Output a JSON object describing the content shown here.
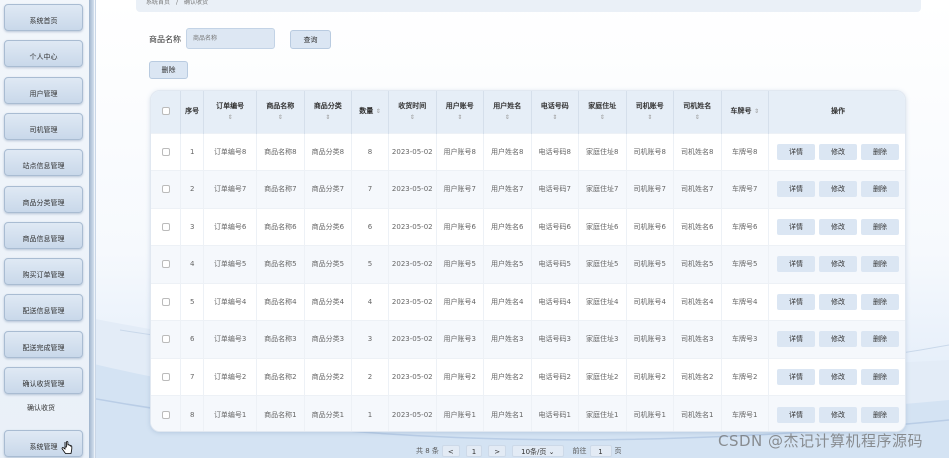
{
  "breadcrumb": [
    "系统首页",
    "确认收货"
  ],
  "sidebar": {
    "items": [
      {
        "label": "系统首页"
      },
      {
        "label": "个人中心"
      },
      {
        "label": "用户管理"
      },
      {
        "label": "司机管理"
      },
      {
        "label": "站点信息管理"
      },
      {
        "label": "商品分类管理"
      },
      {
        "label": "商品信息管理"
      },
      {
        "label": "购买订单管理"
      },
      {
        "label": "配送信息管理"
      },
      {
        "label": "配送完成管理"
      },
      {
        "label": "确认收货管理"
      }
    ],
    "subitem": {
      "label": "确认收货"
    },
    "last_item": {
      "label": "系统管理"
    }
  },
  "search": {
    "label": "商品名称",
    "placeholder": "商品名称",
    "query_button": "查询",
    "delete_button": "删除"
  },
  "table": {
    "headers": [
      "序号",
      "订单编号",
      "商品名称",
      "商品分类",
      "数量",
      "收货时间",
      "用户账号",
      "用户姓名",
      "电话号码",
      "家庭住址",
      "司机账号",
      "司机姓名",
      "车牌号",
      "操作"
    ],
    "sort_icon": "⇕",
    "rows": [
      {
        "index": "1",
        "order": "订单编号8",
        "name": "商品名称8",
        "category": "商品分类8",
        "qty": "8",
        "time": "2023-05-02",
        "user": "用户账号8",
        "uname": "用户姓名8",
        "phone": "电话号码8",
        "addr": "家庭住址8",
        "driver": "司机账号8",
        "dname": "司机姓名8",
        "plate": "车牌号8"
      },
      {
        "index": "2",
        "order": "订单编号7",
        "name": "商品名称7",
        "category": "商品分类7",
        "qty": "7",
        "time": "2023-05-02",
        "user": "用户账号7",
        "uname": "用户姓名7",
        "phone": "电话号码7",
        "addr": "家庭住址7",
        "driver": "司机账号7",
        "dname": "司机姓名7",
        "plate": "车牌号7"
      },
      {
        "index": "3",
        "order": "订单编号6",
        "name": "商品名称6",
        "category": "商品分类6",
        "qty": "6",
        "time": "2023-05-02",
        "user": "用户账号6",
        "uname": "用户姓名6",
        "phone": "电话号码6",
        "addr": "家庭住址6",
        "driver": "司机账号6",
        "dname": "司机姓名6",
        "plate": "车牌号6"
      },
      {
        "index": "4",
        "order": "订单编号5",
        "name": "商品名称5",
        "category": "商品分类5",
        "qty": "5",
        "time": "2023-05-02",
        "user": "用户账号5",
        "uname": "用户姓名5",
        "phone": "电话号码5",
        "addr": "家庭住址5",
        "driver": "司机账号5",
        "dname": "司机姓名5",
        "plate": "车牌号5"
      },
      {
        "index": "5",
        "order": "订单编号4",
        "name": "商品名称4",
        "category": "商品分类4",
        "qty": "4",
        "time": "2023-05-02",
        "user": "用户账号4",
        "uname": "用户姓名4",
        "phone": "电话号码4",
        "addr": "家庭住址4",
        "driver": "司机账号4",
        "dname": "司机姓名4",
        "plate": "车牌号4"
      },
      {
        "index": "6",
        "order": "订单编号3",
        "name": "商品名称3",
        "category": "商品分类3",
        "qty": "3",
        "time": "2023-05-02",
        "user": "用户账号3",
        "uname": "用户姓名3",
        "phone": "电话号码3",
        "addr": "家庭住址3",
        "driver": "司机账号3",
        "dname": "司机姓名3",
        "plate": "车牌号3"
      },
      {
        "index": "7",
        "order": "订单编号2",
        "name": "商品名称2",
        "category": "商品分类2",
        "qty": "2",
        "time": "2023-05-02",
        "user": "用户账号2",
        "uname": "用户姓名2",
        "phone": "电话号码2",
        "addr": "家庭住址2",
        "driver": "司机账号2",
        "dname": "司机姓名2",
        "plate": "车牌号2"
      },
      {
        "index": "8",
        "order": "订单编号1",
        "name": "商品名称1",
        "category": "商品分类1",
        "qty": "1",
        "time": "2023-05-02",
        "user": "用户账号1",
        "uname": "用户姓名1",
        "phone": "电话号码1",
        "addr": "家庭住址1",
        "driver": "司机账号1",
        "dname": "司机姓名1",
        "plate": "车牌号1"
      }
    ],
    "actions": {
      "detail": "详情",
      "edit": "修改",
      "delete": "删除"
    }
  },
  "pager": {
    "total": "共 8 条",
    "prev": "<",
    "page": "1",
    "next": ">",
    "page_size": "10条/页",
    "goto_label": "前往",
    "goto_value": "1",
    "page_suffix": "页"
  },
  "watermark": "CSDN @杰记计算机程序源码",
  "colors": {
    "accent": "#dbe6f3",
    "header_bg": "#e6eef7",
    "sidebar_btn": "#c9d8ea"
  }
}
